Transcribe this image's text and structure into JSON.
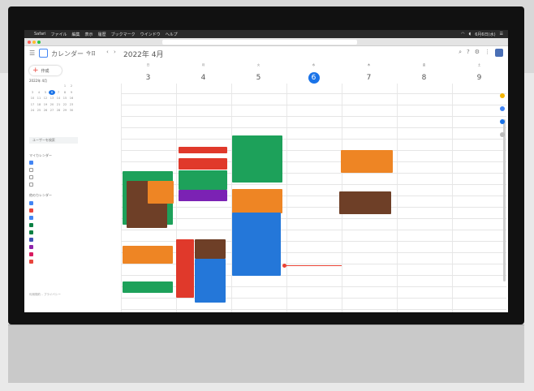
{
  "browser": {
    "menubar_app": "Safari",
    "menubar_items": [
      "ファイル",
      "編集",
      "表示",
      "履歴",
      "ブックマーク",
      "ウインドウ",
      "ヘルプ"
    ],
    "clock": "6月6日(水)"
  },
  "header": {
    "app_name": "カレンダー",
    "today": "今日",
    "month": "2022年 4月"
  },
  "sidebar": {
    "create_label": "作成",
    "minical_title": "2022年 4月",
    "minical_days": [
      "",
      "",
      "",
      "",
      "",
      "1",
      "2",
      "3",
      "4",
      "5",
      "6",
      "7",
      "8",
      "9",
      "10",
      "11",
      "12",
      "13",
      "14",
      "15",
      "16",
      "17",
      "18",
      "19",
      "20",
      "21",
      "22",
      "23",
      "24",
      "25",
      "26",
      "27",
      "28",
      "29",
      "30"
    ],
    "search_people": "ユーザーを検索",
    "my_calendars_title": "マイカレンダー",
    "my_calendars": [
      "",
      "",
      "",
      ""
    ],
    "other_calendars_title": "他のカレンダー",
    "other_calendars": [
      "",
      "",
      "",
      "",
      "",
      "",
      "",
      "",
      ""
    ],
    "footer": "利用規約 – プライバシー"
  },
  "colors": {
    "green": "#1da15a",
    "orange": "#ee8524",
    "brown": "#6e3f27",
    "red": "#e0392b",
    "blue": "#2477d9",
    "purple": "#7b22b4",
    "today": "#1a73e8"
  },
  "grid": {
    "days": [
      {
        "dow": "日",
        "num": "3"
      },
      {
        "dow": "月",
        "num": "4"
      },
      {
        "dow": "火",
        "num": "5"
      },
      {
        "dow": "水",
        "num": "6",
        "today": true
      },
      {
        "dow": "木",
        "num": "7"
      },
      {
        "dow": "金",
        "num": "8"
      },
      {
        "dow": "土",
        "num": "9"
      }
    ]
  }
}
